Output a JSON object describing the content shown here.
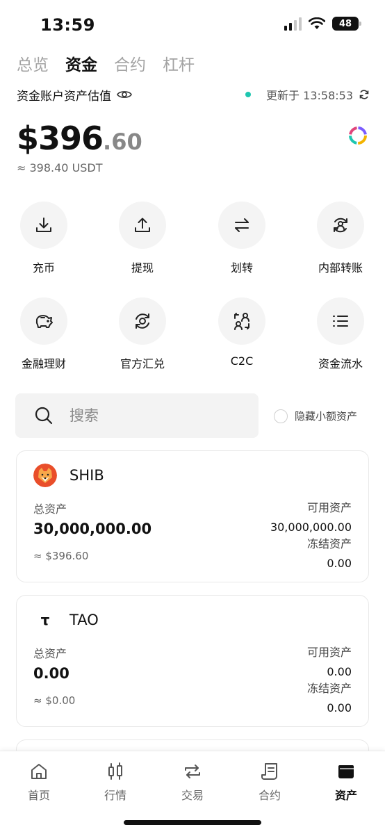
{
  "status_bar": {
    "time": "13:59",
    "battery": "48"
  },
  "top_tabs": [
    {
      "label": "总览",
      "active": false
    },
    {
      "label": "资金",
      "active": true
    },
    {
      "label": "合约",
      "active": false
    },
    {
      "label": "杠杆",
      "active": false
    }
  ],
  "valuation": {
    "label": "资金账户资产估值",
    "update_text": "更新于 13:58:53",
    "balance_int": "$396",
    "balance_dec": ".60",
    "balance_usdt": "≈ 398.40 USDT"
  },
  "actions": [
    {
      "label": "充币",
      "icon": "download-icon"
    },
    {
      "label": "提现",
      "icon": "upload-icon"
    },
    {
      "label": "划转",
      "icon": "transfer-icon"
    },
    {
      "label": "内部转账",
      "icon": "user-transfer-icon"
    },
    {
      "label": "金融理财",
      "icon": "piggy-bank-icon"
    },
    {
      "label": "官方汇兑",
      "icon": "exchange-icon"
    },
    {
      "label": "C2C",
      "icon": "c2c-icon"
    },
    {
      "label": "资金流水",
      "icon": "list-icon"
    }
  ],
  "search": {
    "placeholder": "搜索"
  },
  "hide_small": {
    "label": "隐藏小额资产",
    "checked": false
  },
  "assets": [
    {
      "name": "SHIB",
      "total_label": "总资产",
      "total": "30,000,000.00",
      "usd": "≈ $396.60",
      "available_label": "可用资产",
      "available": "30,000,000.00",
      "frozen_label": "冻结资产",
      "frozen": "0.00"
    },
    {
      "name": "TAO",
      "logo_text": "τ",
      "total_label": "总资产",
      "total": "0.00",
      "usd": "≈ $0.00",
      "available_label": "可用资产",
      "available": "0.00",
      "frozen_label": "冻结资产",
      "frozen": "0.00"
    }
  ],
  "bottom_nav": [
    {
      "label": "首页",
      "icon": "home-icon",
      "active": false
    },
    {
      "label": "行情",
      "icon": "candlestick-icon",
      "active": false
    },
    {
      "label": "交易",
      "icon": "swap-icon",
      "active": false
    },
    {
      "label": "合约",
      "icon": "contract-icon",
      "active": false
    },
    {
      "label": "资产",
      "icon": "wallet-icon",
      "active": true
    }
  ],
  "colors": {
    "live_dot": "#1ec6b0",
    "accent": "#111111",
    "muted": "#a3a3a3"
  }
}
